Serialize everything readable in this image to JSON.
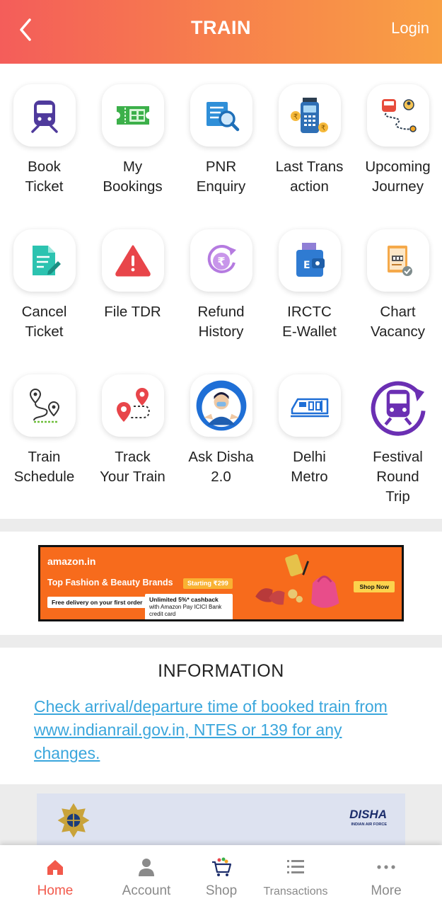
{
  "header": {
    "title": "TRAIN",
    "login": "Login"
  },
  "grid": [
    {
      "label": "Book\nTicket",
      "icon": "train-icon"
    },
    {
      "label": "My\nBookings",
      "icon": "ticket-icon"
    },
    {
      "label": "PNR\nEnquiry",
      "icon": "document-search-icon"
    },
    {
      "label": "Last Trans\naction",
      "icon": "payment-terminal-icon"
    },
    {
      "label": "Upcoming\nJourney",
      "icon": "journey-route-icon"
    },
    {
      "label": "Cancel\nTicket",
      "icon": "edit-document-icon"
    },
    {
      "label": "File TDR",
      "icon": "warning-icon"
    },
    {
      "label": "Refund\nHistory",
      "icon": "rupee-refund-icon"
    },
    {
      "label": "IRCTC\nE-Wallet",
      "icon": "wallet-icon"
    },
    {
      "label": "Chart\nVacancy",
      "icon": "chart-document-icon"
    },
    {
      "label": "Train\nSchedule",
      "icon": "route-pins-icon"
    },
    {
      "label": "Track\nYour Train",
      "icon": "location-pins-icon"
    },
    {
      "label": "Ask Disha\n2.0",
      "icon": "disha-assistant-icon"
    },
    {
      "label": "Delhi\nMetro",
      "icon": "metro-train-icon"
    },
    {
      "label": "Festival\nRound\nTrip",
      "icon": "round-trip-train-icon"
    }
  ],
  "ad_banner": {
    "logo": "amazon.in",
    "headline": "Top Fashion & Beauty Brands",
    "price_tag": "Starting ₹299",
    "free_delivery": "Free delivery on your first order",
    "cashback_title": "Unlimited 5%* cashback",
    "cashback_sub": "with Amazon Pay ICICI Bank credit card",
    "cta": "Shop Now"
  },
  "information": {
    "title": "INFORMATION",
    "link_text": "Check arrival/departure time of booked train from www.indianrail.gov.in, NTES or 139 for any changes."
  },
  "banner2": {
    "brand": "DISHA",
    "sub": "INDIAN AIR FORCE"
  },
  "bottom_nav": [
    {
      "label": "Home",
      "icon": "home-icon",
      "active": true
    },
    {
      "label": "Account",
      "icon": "person-icon",
      "active": false
    },
    {
      "label": "Shop",
      "icon": "cart-icon",
      "active": false
    },
    {
      "label": "Transactions",
      "icon": "list-icon",
      "active": false
    },
    {
      "label": "More",
      "icon": "more-dots-icon",
      "active": false
    }
  ],
  "colors": {
    "header_start": "#f45d5a",
    "header_end": "#f9a044",
    "active_nav": "#f2594b",
    "link": "#3aa6dc"
  }
}
